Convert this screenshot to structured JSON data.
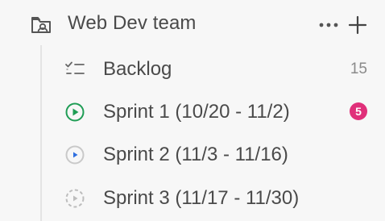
{
  "team": {
    "name": "Web Dev team",
    "icon": "team-folder-icon"
  },
  "items": [
    {
      "label": "Backlog",
      "icon": "backlog-icon",
      "count": "15"
    },
    {
      "label": "Sprint 1 (10/20 - 11/2)",
      "icon": "sprint-current-icon",
      "badge": "5",
      "badge_color": "#e0307a",
      "icon_color": "#1f9d55"
    },
    {
      "label": "Sprint 2 (11/3 - 11/16)",
      "icon": "sprint-upcoming-icon",
      "icon_color": "#2f6fe0"
    },
    {
      "label": "Sprint 3 (11/17 - 11/30)",
      "icon": "sprint-future-icon",
      "icon_color": "#b8b8b8"
    }
  ]
}
